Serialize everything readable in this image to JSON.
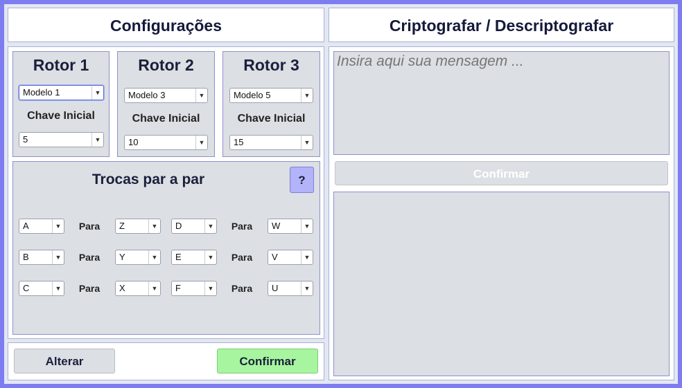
{
  "config": {
    "title": "Configurações",
    "rotors": [
      {
        "title": "Rotor 1",
        "model": "Modelo 1",
        "key_label": "Chave Inicial",
        "key": "5"
      },
      {
        "title": "Rotor 2",
        "model": "Modelo 3",
        "key_label": "Chave Inicial",
        "key": "10"
      },
      {
        "title": "Rotor 3",
        "model": "Modelo 5",
        "key_label": "Chave Inicial",
        "key": "15"
      }
    ],
    "plugboard": {
      "title": "Trocas par a par",
      "help": "?",
      "para": "Para",
      "pairs": [
        {
          "from": "A",
          "to": "Z"
        },
        {
          "from": "B",
          "to": "Y"
        },
        {
          "from": "C",
          "to": "X"
        },
        {
          "from": "D",
          "to": "W"
        },
        {
          "from": "E",
          "to": "V"
        },
        {
          "from": "F",
          "to": "U"
        }
      ]
    },
    "alter_label": "Alterar",
    "confirm_label": "Confirmar"
  },
  "crypto": {
    "title": "Criptografar / Descriptografar",
    "input_placeholder": "Insira aqui sua mensagem ...",
    "confirm_label": "Confirmar",
    "output": ""
  },
  "colors": {
    "frame": "#7d7cf0",
    "panel_gray": "#dcdfe3",
    "confirm_green": "#a8f5a0",
    "help_purple": "#b3b3f9"
  },
  "icons": {
    "dropdown": "▼"
  }
}
